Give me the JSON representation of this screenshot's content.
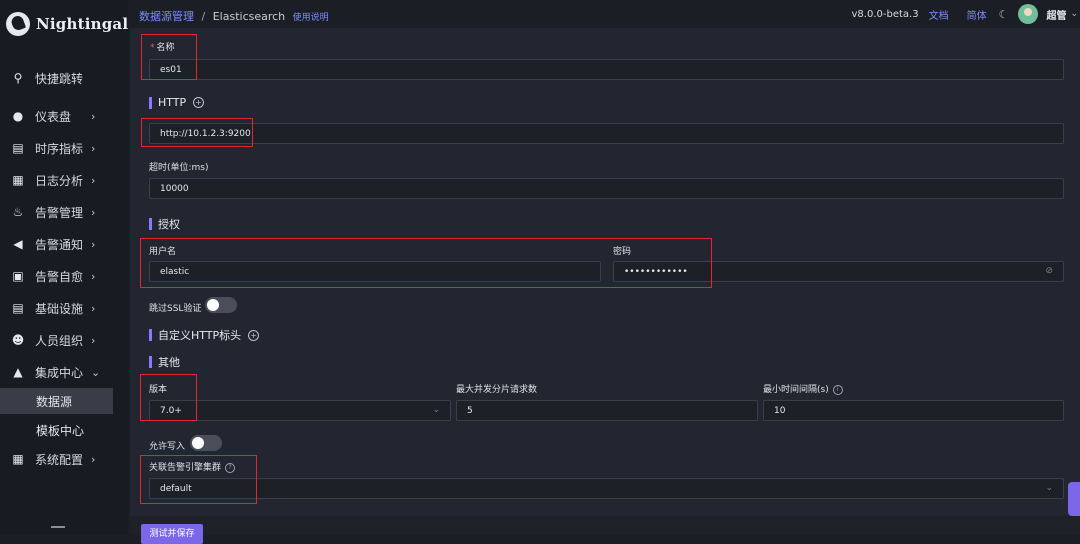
{
  "app": {
    "name": "Nightingale"
  },
  "topbar": {
    "crumb_main": "数据源管理",
    "crumb_sep": "/",
    "crumb_current": "Elasticsearch",
    "help_link": "使用说明",
    "version": "v8.0.0-beta.3",
    "docs": "文档",
    "lang": "简体",
    "user": "超管"
  },
  "sidebar": {
    "items": [
      {
        "label": "快捷跳转",
        "icon": "search-icon"
      },
      {
        "label": "仪表盘",
        "icon": "dashboard-icon"
      },
      {
        "label": "时序指标",
        "icon": "chart-icon"
      },
      {
        "label": "日志分析",
        "icon": "log-icon"
      },
      {
        "label": "告警管理",
        "icon": "bell-icon"
      },
      {
        "label": "告警通知",
        "icon": "megaphone-icon"
      },
      {
        "label": "告警自愈",
        "icon": "terminal-icon"
      },
      {
        "label": "基础设施",
        "icon": "server-icon"
      },
      {
        "label": "人员组织",
        "icon": "user-icon"
      },
      {
        "label": "集成中心",
        "icon": "integration-icon"
      },
      {
        "label": "系统配置",
        "icon": "settings-icon"
      }
    ],
    "sub_items": [
      "数据源",
      "模板中心"
    ]
  },
  "form": {
    "name_label": "名称",
    "name_value": "es01",
    "http_section": "HTTP",
    "url_value": "http://10.1.2.3:9200",
    "timeout_label": "超时(单位:ms)",
    "timeout_value": "10000",
    "auth_section": "授权",
    "username_label": "用户名",
    "username_value": "elastic",
    "password_label": "密码",
    "password_value": "••••••••••••",
    "ssl_label": "跳过SSL验证",
    "custom_headers_section": "自定义HTTP标头",
    "other_section": "其他",
    "version_label": "版本",
    "version_value": "7.0+",
    "max_shard_label": "最大并发分片请求数",
    "max_shard_value": "5",
    "min_interval_label": "最小时间间隔(s)",
    "min_interval_value": "10",
    "allow_write_label": "允许写入",
    "cluster_label": "关联告警引擎集群",
    "cluster_value": "default",
    "submit": "测试并保存"
  }
}
